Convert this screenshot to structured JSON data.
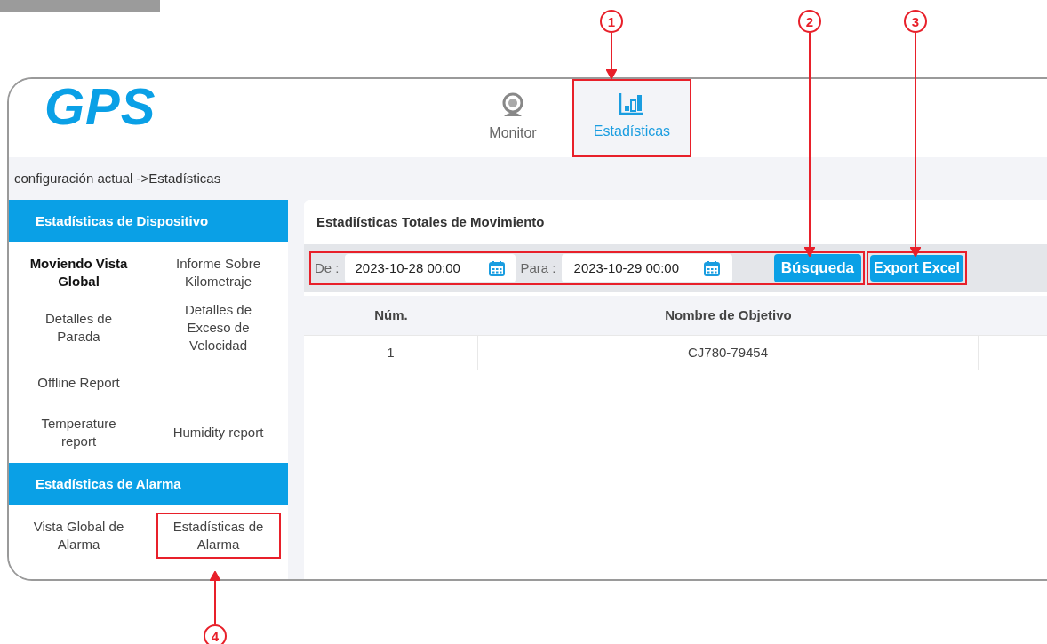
{
  "logo": "GPS",
  "nav": [
    {
      "label": "Monitor",
      "selected": false,
      "highlighted": false
    },
    {
      "label": "Estadísticas",
      "selected": true,
      "highlighted": true
    }
  ],
  "breadcrumb": "configuración actual ->Estadísticas",
  "sidebar": [
    {
      "title": "Estadísticas de Dispositivo",
      "rows": [
        {
          "items": [
            {
              "label": "Moviendo Vista Global",
              "selected": true,
              "highlighted": false
            },
            {
              "label": "Informe Sobre Kilometraje",
              "selected": false,
              "highlighted": false
            }
          ]
        },
        {
          "items": [
            {
              "label": "Detalles de Parada",
              "selected": false,
              "highlighted": false
            },
            {
              "label": "Detalles de Exceso de Velocidad",
              "selected": false,
              "highlighted": false
            }
          ]
        },
        {
          "items": [
            {
              "label": "Offline Report",
              "selected": false,
              "highlighted": false
            }
          ]
        },
        {
          "items": [
            {
              "label": "Temperature report",
              "selected": false,
              "highlighted": false
            },
            {
              "label": "Humidity report",
              "selected": false,
              "highlighted": false
            }
          ]
        }
      ]
    },
    {
      "title": "Estadísticas de Alarma",
      "rows": [
        {
          "items": [
            {
              "label": "Vista Global de Alarma",
              "selected": false,
              "highlighted": false
            },
            {
              "label": "Estadísticas de Alarma",
              "selected": false,
              "highlighted": true
            }
          ]
        }
      ]
    }
  ],
  "main": {
    "title": "Estadiísticas Totales de Movimiento",
    "from": {
      "label": "De :",
      "value": "2023-10-28 00:00"
    },
    "to": {
      "label": "Para :",
      "value": "2023-10-29 00:00"
    },
    "search_button": "Búsqueda",
    "export_button": "Export Excel",
    "table": {
      "columns": [
        "Núm.",
        "Nombre de Objetivo"
      ],
      "rows": [
        [
          "1",
          "CJ780-79454"
        ]
      ]
    }
  },
  "callouts": [
    "1",
    "2",
    "3",
    "4"
  ]
}
